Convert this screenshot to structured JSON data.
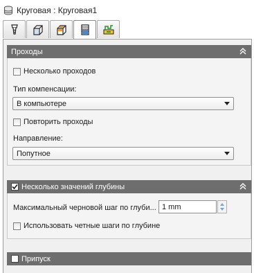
{
  "window": {
    "title": "Круговая : Круговая1"
  },
  "tabs": [
    {
      "icon": "tool-icon"
    },
    {
      "icon": "shape-icon"
    },
    {
      "icon": "stock-icon"
    },
    {
      "icon": "passes-icon",
      "active": true
    },
    {
      "icon": "linking-icon"
    }
  ],
  "passes": {
    "header": "Проходы",
    "multiple_passes_label": "Несколько проходов",
    "compensation_label": "Тип компенсации:",
    "compensation_value": "В компьютере",
    "repeat_passes_label": "Повторить проходы",
    "direction_label": "Направление:",
    "direction_value": "Попутное"
  },
  "depth": {
    "header": "Несколько значений глубины",
    "header_checked": true,
    "max_step_label": "Максимальный черновой шаг по глуби...",
    "max_step_value": "1 mm",
    "even_steps_label": "Использовать четные шаги по глубине"
  },
  "allowance": {
    "header": "Припуск"
  },
  "colors": {
    "section_header_bg": "#6e6e6e",
    "panel_bg": "#f0f0f0"
  }
}
